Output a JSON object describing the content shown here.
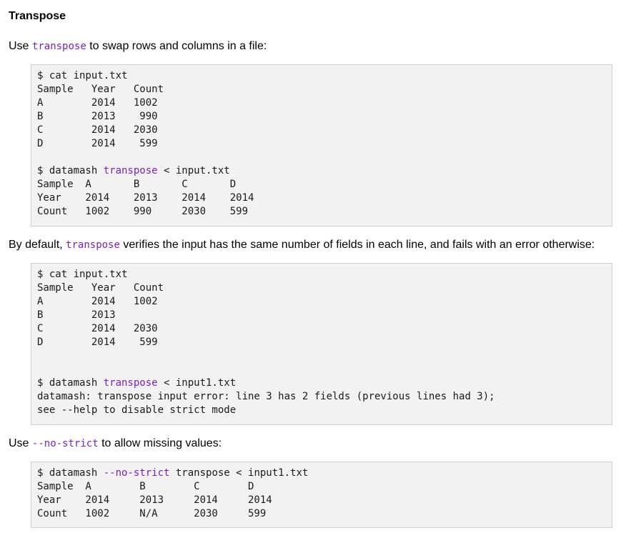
{
  "heading": "Transpose",
  "para1": {
    "pre": "Use ",
    "code": "transpose",
    "post": " to swap rows and columns in a file:"
  },
  "box1": {
    "l1": "$ cat input.txt",
    "l2": "Sample   Year   Count",
    "l3": "A        2014   1002",
    "l4": "B        2013    990",
    "l5": "C        2014   2030",
    "l6": "D        2014    599",
    "l7": "",
    "l8_pre": "$ datamash ",
    "l8_kw": "transpose",
    "l8_post": " < input.txt",
    "l9": "Sample  A       B       C       D",
    "l10": "Year    2014    2013    2014    2014",
    "l11": "Count   1002    990     2030    599"
  },
  "para2": {
    "pre": "By default, ",
    "code": "transpose",
    "post": " verifies the input has the same number of fields in each line, and fails with an error otherwise:"
  },
  "box2": {
    "l1": "$ cat input.txt",
    "l2": "Sample   Year   Count",
    "l3": "A        2014   1002",
    "l4": "B        2013",
    "l5": "C        2014   2030",
    "l6": "D        2014    599",
    "l7": "",
    "l8": "",
    "l9_pre": "$ datamash ",
    "l9_kw": "transpose",
    "l9_post": " < input1.txt",
    "l10": "datamash: transpose input error: line 3 has 2 fields (previous lines had 3);",
    "l11": "see --help to disable strict mode"
  },
  "para3": {
    "pre": "Use ",
    "code": "--no-strict",
    "post": " to allow missing values:"
  },
  "box3": {
    "l1_pre": "$ datamash ",
    "l1_kw": "--no-strict",
    "l1_post": " transpose < input1.txt",
    "l2": "Sample  A        B        C        D",
    "l3": "Year    2014     2013     2014     2014",
    "l4": "Count   1002     N/A      2030     599"
  }
}
